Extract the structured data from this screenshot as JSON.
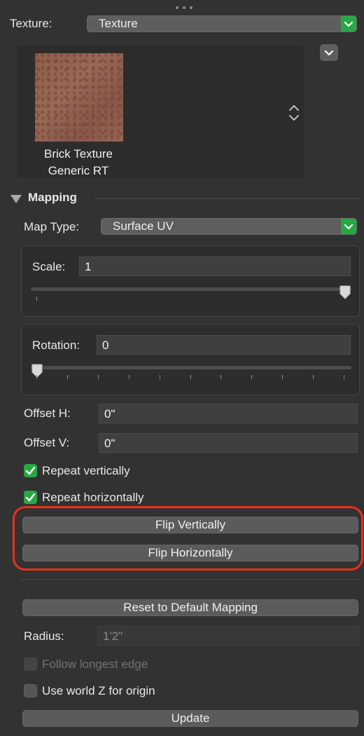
{
  "texture": {
    "label": "Texture:",
    "selected": "Texture",
    "preview_name_line1": "Brick Texture",
    "preview_name_line2": "Generic RT"
  },
  "mapping": {
    "section_title": "Mapping",
    "map_type_label": "Map Type:",
    "map_type_value": "Surface UV",
    "scale_label": "Scale:",
    "scale_value": "1",
    "scale_slider_fraction": 1.0,
    "rotation_label": "Rotation:",
    "rotation_value": "0",
    "rotation_slider_fraction": 0.0,
    "offset_h_label": "Offset H:",
    "offset_h_value": "0\"",
    "offset_v_label": "Offset V:",
    "offset_v_value": "0\"",
    "repeat_vertically_label": "Repeat vertically",
    "repeat_vertically_checked": true,
    "repeat_horizontally_label": "Repeat horizontally",
    "repeat_horizontally_checked": true,
    "flip_vertically_label": "Flip Vertically",
    "flip_horizontally_label": "Flip Horizontally",
    "reset_label": "Reset to Default Mapping",
    "radius_label": "Radius:",
    "radius_value": "1'2\"",
    "follow_longest_edge_label": "Follow longest edge",
    "follow_longest_edge_checked": false,
    "follow_longest_edge_enabled": false,
    "use_world_z_label": "Use world Z for origin",
    "use_world_z_checked": false,
    "update_label": "Update"
  },
  "colors": {
    "accent_green": "#28a745",
    "highlight_red": "#e8301c",
    "panel_bg": "#323232"
  },
  "icons": [
    "more-dots-icon",
    "chevron-down-icon",
    "up-down-stepper-icon",
    "disclosure-triangle-icon",
    "checkmark-icon"
  ]
}
